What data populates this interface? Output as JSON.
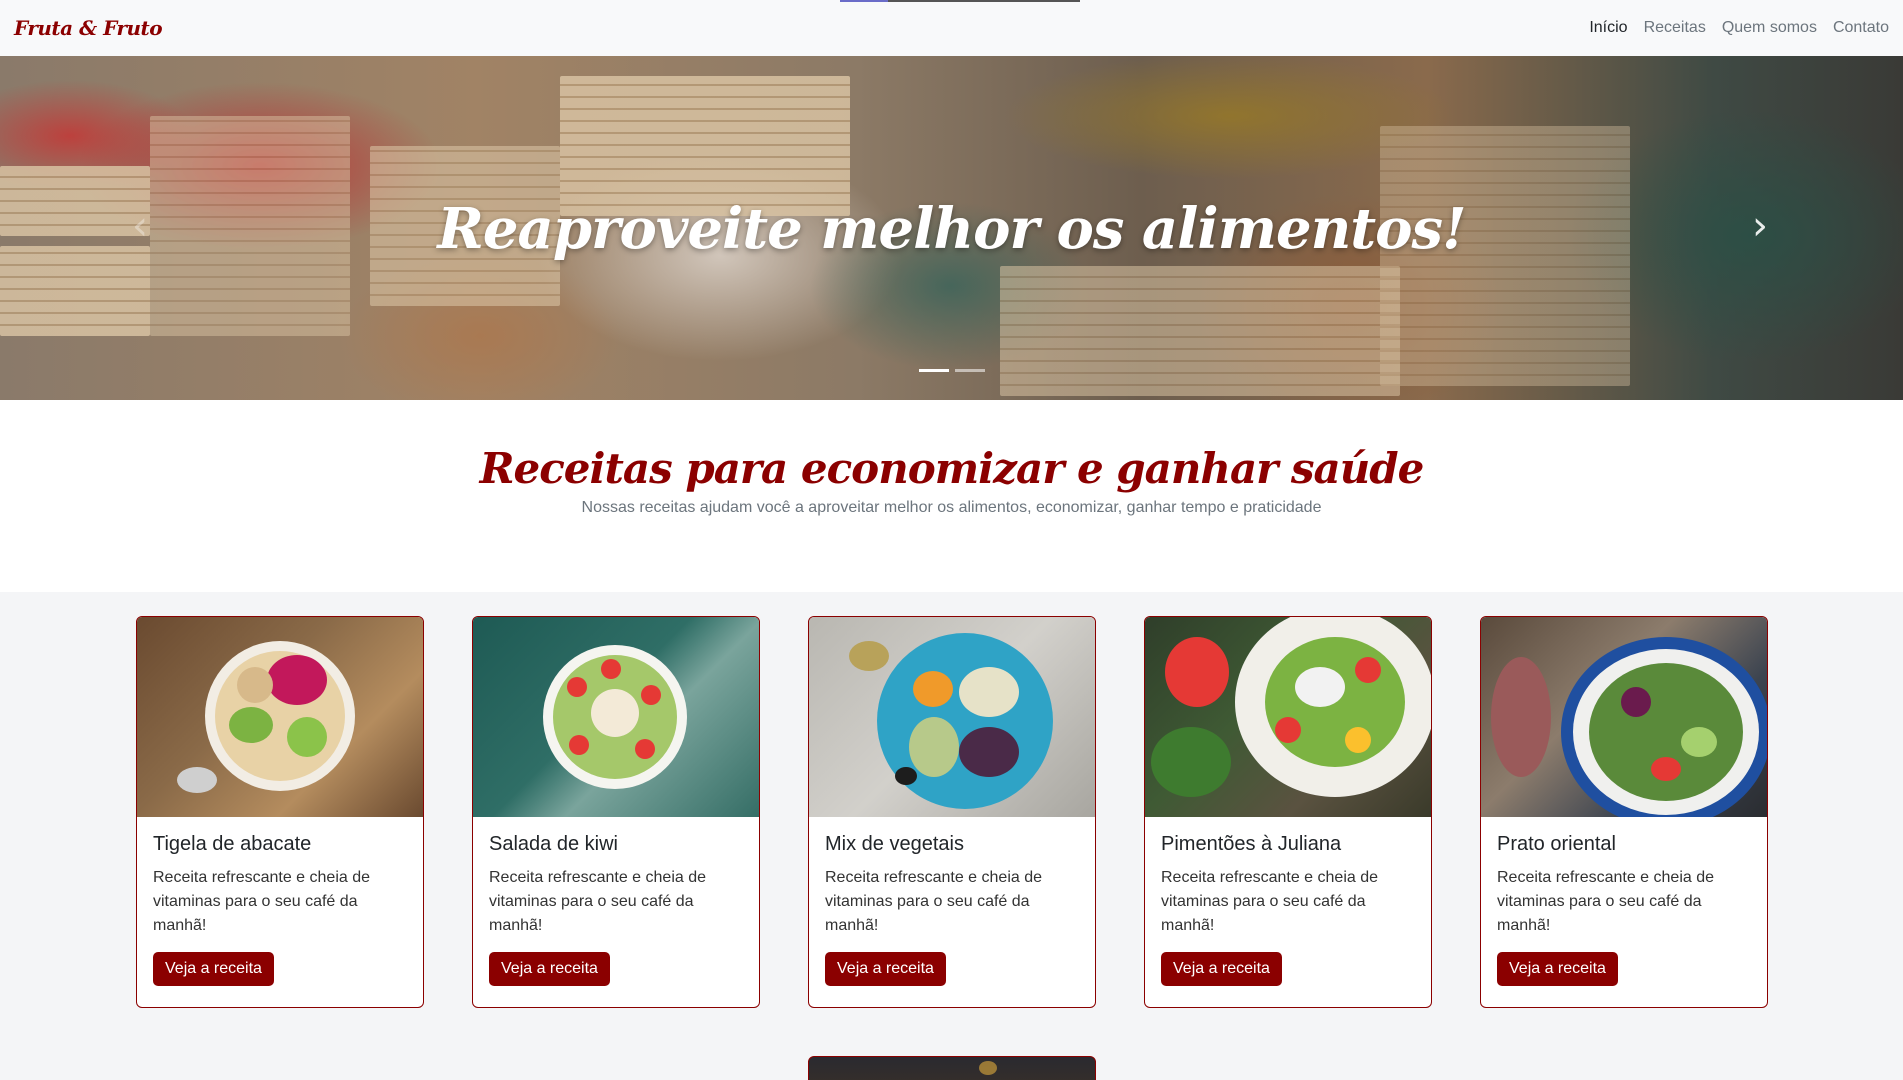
{
  "nav": {
    "brand": "Fruta & Fruto",
    "links": [
      "Início",
      "Receitas",
      "Quem somos",
      "Contato"
    ]
  },
  "hero": {
    "title": "Reaproveite melhor os alimentos!",
    "prev_icon": "chevron-left-icon",
    "next_icon": "chevron-right-icon",
    "slides_count": 2,
    "active_slide": 1
  },
  "intro": {
    "title": "Receitas para economizar e ganhar saúde",
    "subtitle": "Nossas receitas ajudam você a aproveitar melhor os alimentos, economizar, ganhar tempo e praticidade"
  },
  "cards": [
    {
      "title": "Tigela de abacate",
      "text": "Receita refrescante e cheia de vitaminas para o seu café da manhã!",
      "button": "Veja a receita"
    },
    {
      "title": "Salada de kiwi",
      "text": "Receita refrescante e cheia de vitaminas para o seu café da manhã!",
      "button": "Veja a receita"
    },
    {
      "title": "Mix de vegetais",
      "text": "Receita refrescante e cheia de vitaminas para o seu café da manhã!",
      "button": "Veja a receita"
    },
    {
      "title": "Pimentões à Juliana",
      "text": "Receita refrescante e cheia de vitaminas para o seu café da manhã!",
      "button": "Veja a receita"
    },
    {
      "title": "Prato oriental",
      "text": "Receita refrescante e cheia de vitaminas para o seu café da manhã!",
      "button": "Veja a receita"
    }
  ],
  "colors": {
    "brand": "#8b0000",
    "navbar_bg": "#f8f9fa",
    "section_bg": "#f4f5f7"
  }
}
